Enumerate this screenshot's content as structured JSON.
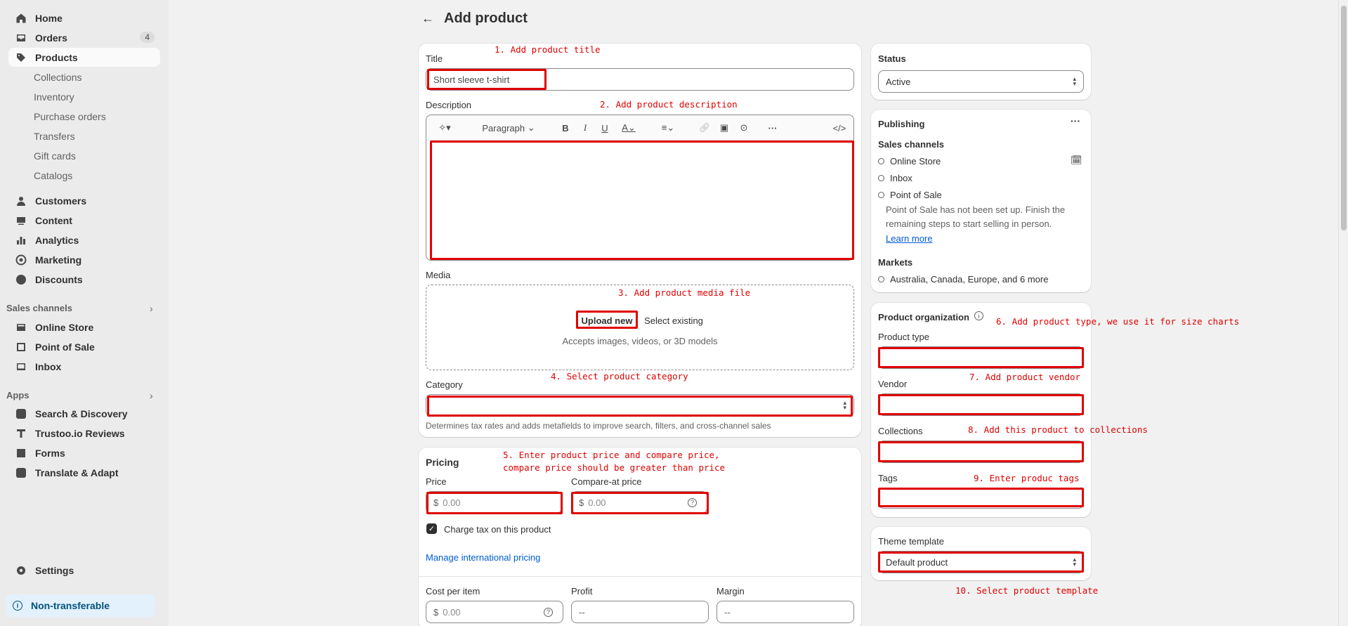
{
  "sidebar": {
    "home": "Home",
    "orders": "Orders",
    "orders_badge": "4",
    "products": "Products",
    "products_sub": [
      "Collections",
      "Inventory",
      "Purchase orders",
      "Transfers",
      "Gift cards",
      "Catalogs"
    ],
    "customers": "Customers",
    "content": "Content",
    "analytics": "Analytics",
    "marketing": "Marketing",
    "discounts": "Discounts",
    "sales_channels_header": "Sales channels",
    "sales_channels": [
      "Online Store",
      "Point of Sale",
      "Inbox"
    ],
    "apps_header": "Apps",
    "apps": [
      "Search & Discovery",
      "Trustoo.io Reviews",
      "Forms",
      "Translate & Adapt"
    ],
    "settings": "Settings",
    "non_transferable": "Non-transferable"
  },
  "page": {
    "back_icon": "arrow-left-icon",
    "title": "Add product"
  },
  "product_card": {
    "title_label": "Title",
    "title_value": "Short sleeve t-shirt",
    "description_label": "Description",
    "paragraph_label": "Paragraph",
    "media_label": "Media",
    "upload_new": "Upload new",
    "select_existing": "Select existing",
    "media_hint": "Accepts images, videos, or 3D models",
    "category_label": "Category",
    "category_hint": "Determines tax rates and adds metafields to improve search, filters, and cross-channel sales"
  },
  "pricing": {
    "heading": "Pricing",
    "price_label": "Price",
    "price_placeholder": "0.00",
    "compare_label": "Compare-at price",
    "compare_placeholder": "0.00",
    "currency": "$",
    "charge_tax": "Charge tax on this product",
    "manage_intl": "Manage international pricing",
    "cost_label": "Cost per item",
    "cost_placeholder": "0.00",
    "profit_label": "Profit",
    "profit_value": "--",
    "margin_label": "Margin",
    "margin_value": "--"
  },
  "status": {
    "label": "Status",
    "value": "Active"
  },
  "publishing": {
    "heading": "Publishing",
    "sales_channels_label": "Sales channels",
    "channels": [
      "Online Store",
      "Inbox",
      "Point of Sale"
    ],
    "pos_note_line1": "Point of Sale has not been set up. Finish the",
    "pos_note_line2": "remaining steps to start selling in person.",
    "learn_more": "Learn more",
    "markets_label": "Markets",
    "markets_value": "Australia, Canada, Europe, and 6 more"
  },
  "organization": {
    "heading": "Product organization",
    "product_type": "Product type",
    "vendor": "Vendor",
    "collections": "Collections",
    "tags": "Tags"
  },
  "theme": {
    "label": "Theme template",
    "value": "Default product"
  },
  "annotations": {
    "a1": "1. Add product title",
    "a2": "2. Add product description",
    "a3": "3. Add product media file",
    "a4": "4. Select product category",
    "a5_line1": "5. Enter product price and compare price,",
    "a5_line2": "compare price should be greater than price",
    "a6": "6. Add product type, we use it for size charts",
    "a7": "7. Add product vendor",
    "a8": "8. Add this product to collections",
    "a9": "9. Enter produc tags",
    "a10": "10. Select product template"
  },
  "colors": {
    "annotation_red": "#e00000",
    "link_blue": "#005bd3",
    "sidebar_bg": "#ebebeb",
    "page_bg": "#f1f1f1"
  }
}
